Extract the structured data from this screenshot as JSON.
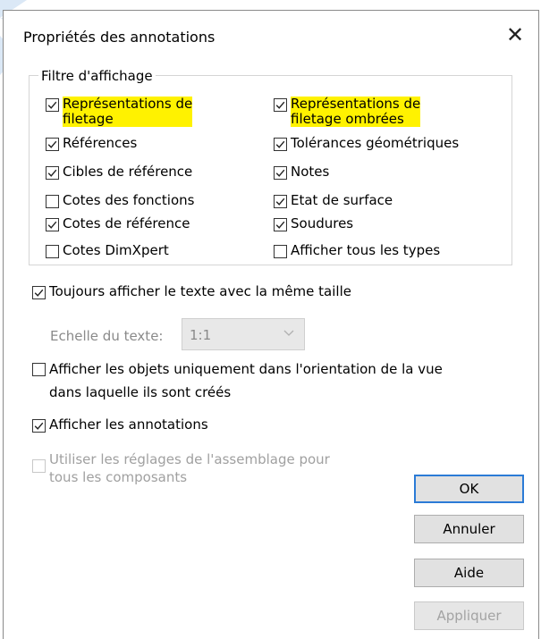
{
  "dialog": {
    "title": "Propriétés des annotations",
    "close_glyph": "✕"
  },
  "filter": {
    "legend": "Filtre d'affichage",
    "left": [
      {
        "label_lines": [
          "Représentations de",
          "filetage"
        ],
        "checked": true,
        "highlighted": true
      },
      {
        "label": "Références",
        "checked": true
      },
      {
        "label": "Cibles de référence",
        "checked": true
      },
      {
        "label": "Cotes des fonctions",
        "checked": false
      },
      {
        "label": "Cotes de référence",
        "checked": true
      },
      {
        "label": "Cotes DimXpert",
        "checked": false
      }
    ],
    "right": [
      {
        "label_lines": [
          "Représentations de",
          "filetage ombrées"
        ],
        "checked": true,
        "highlighted": true
      },
      {
        "label": "Tolérances géométriques",
        "checked": true
      },
      {
        "label": "Notes",
        "checked": true
      },
      {
        "label": "Etat de surface",
        "checked": true
      },
      {
        "label": "Soudures",
        "checked": true
      },
      {
        "label": "Afficher tous les types",
        "checked": false
      }
    ]
  },
  "options": {
    "same_size": {
      "label": "Toujours afficher le texte avec la même taille",
      "checked": true
    },
    "scale": {
      "label": "Echelle du texte:",
      "value": "1:1",
      "disabled": true
    },
    "orientation": {
      "label_lines": [
        "Afficher les objets uniquement dans l'orientation de la vue",
        "dans laquelle ils sont créés"
      ],
      "checked": false
    },
    "show_annotations": {
      "label": "Afficher les annotations",
      "checked": true
    },
    "assembly": {
      "label_lines": [
        "Utiliser les réglages de l'assemblage pour",
        "tous les composants"
      ],
      "checked": false,
      "disabled": true
    }
  },
  "buttons": {
    "ok": "OK",
    "cancel": "Annuler",
    "help": "Aide",
    "apply": "Appliquer"
  },
  "colors": {
    "highlight": "#fff200",
    "accent_border": "#2b7bd6"
  }
}
